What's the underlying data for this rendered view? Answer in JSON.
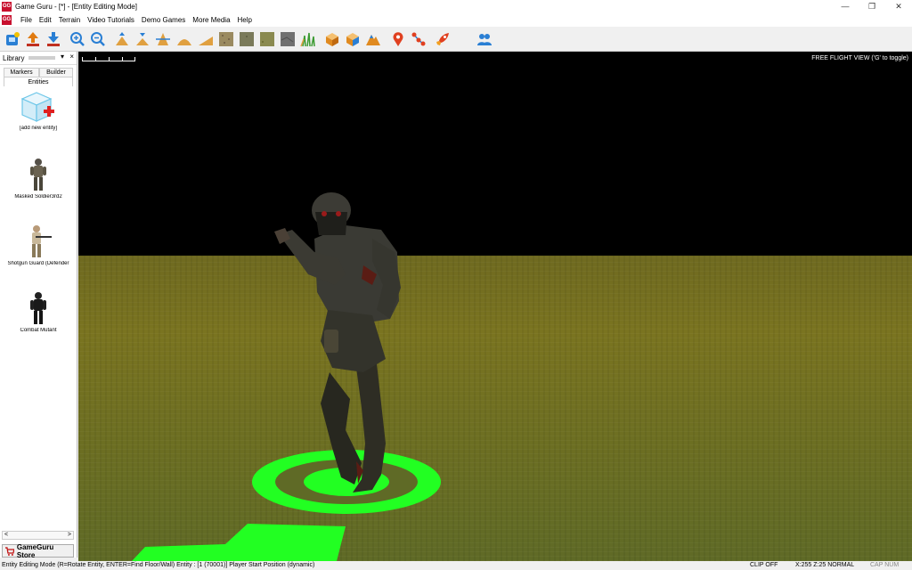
{
  "window": {
    "title": "Game Guru - [*] - [Entity Editing Mode]",
    "app_badge": "GG",
    "controls": [
      "—",
      "❐",
      "✕"
    ]
  },
  "menu": [
    "File",
    "Edit",
    "Terrain",
    "Video Tutorials",
    "Demo Games",
    "More Media",
    "Help"
  ],
  "toolbar": {
    "buttons": [
      {
        "name": "new-level-button",
        "icon": "new-icon",
        "color": "#2a7fd4"
      },
      {
        "name": "load-level-button",
        "icon": "open-icon",
        "color": "#e07a10"
      },
      {
        "name": "save-level-button",
        "icon": "save-icon",
        "color": "#2a7fd4"
      },
      {
        "name": "zoom-in-button",
        "icon": "zoom-in-icon",
        "color": "#2a7fd4"
      },
      {
        "name": "zoom-out-button",
        "icon": "zoom-out-icon",
        "color": "#2a7fd4"
      },
      {
        "name": "raise-terrain-button",
        "icon": "raise-terrain-icon",
        "color": "#e0a040"
      },
      {
        "name": "lower-terrain-button",
        "icon": "lower-terrain-icon",
        "color": "#e0a040"
      },
      {
        "name": "level-terrain-button",
        "icon": "level-terrain-icon",
        "color": "#e0a040"
      },
      {
        "name": "blend-terrain-button",
        "icon": "blend-terrain-icon",
        "color": "#e0a040"
      },
      {
        "name": "ramp-terrain-button",
        "icon": "ramp-terrain-icon",
        "color": "#e0a040"
      },
      {
        "name": "paint-texture-1-button",
        "icon": "texture-dirt-icon",
        "color": "#9a8a60"
      },
      {
        "name": "paint-texture-2-button",
        "icon": "texture-grass-icon",
        "color": "#7a7a5a"
      },
      {
        "name": "paint-texture-3-button",
        "icon": "texture-moss-icon",
        "color": "#8a8a50"
      },
      {
        "name": "paint-texture-4-button",
        "icon": "texture-rock-icon",
        "color": "#707070"
      },
      {
        "name": "paint-grass-button",
        "icon": "grass-icon",
        "color": "#3a9a30"
      },
      {
        "name": "entity-mode-button",
        "icon": "entity-cube-icon",
        "color": "#e08a20"
      },
      {
        "name": "marker-mode-button",
        "icon": "marker-cube-icon",
        "color": "#e08a20"
      },
      {
        "name": "terrain-mode-button",
        "icon": "terrain-mountain-icon",
        "color": "#e08a20"
      },
      {
        "name": "waypoint-button",
        "icon": "location-pin-icon",
        "color": "#e04020"
      },
      {
        "name": "waypoint-path-button",
        "icon": "path-nodes-icon",
        "color": "#e04020"
      },
      {
        "name": "test-game-button",
        "icon": "rocket-icon",
        "color": "#e04020"
      },
      {
        "name": "social-vr-button",
        "icon": "users-icon",
        "color": "#2a7fd4"
      }
    ]
  },
  "library": {
    "title": "Library",
    "pin": "▾",
    "close": "×",
    "tabs": [
      "Markers",
      "Builder",
      "Entities"
    ],
    "items": [
      {
        "label": "[add new entity]",
        "icon": "add-entity-icon"
      },
      {
        "label": "Masked Soldier3rd2",
        "icon": "soldier-thumbnail-icon"
      },
      {
        "label": "Shotgun Guard (Defender",
        "icon": "guard-thumbnail-icon"
      },
      {
        "label": "Combat Mutant",
        "icon": "mutant-thumbnail-icon"
      }
    ],
    "scroll_left": "<",
    "scroll_right": ">",
    "store_label": "GameGuru Store"
  },
  "viewport": {
    "flight_hint": "FREE FLIGHT VIEW ('G' to toggle)",
    "marker_color": "#22ff22"
  },
  "status": {
    "main": "Entity Editing Mode (R=Rotate Entity, ENTER=Find Floor/Wall)  Entity : [1 (70001)] Player Start Position (dynamic)",
    "clip": "CLIP OFF",
    "coords": "X:255 Z:25 NORMAL",
    "keys": "CAP NUM SCRL"
  }
}
